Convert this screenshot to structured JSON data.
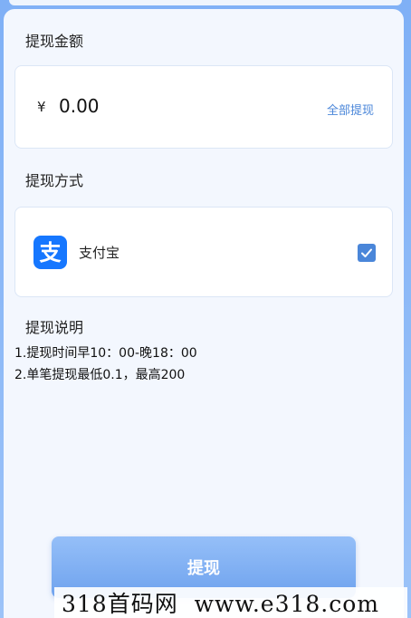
{
  "amount_section": {
    "title": "提现金额",
    "currency": "¥",
    "amount": "0.00",
    "withdraw_all_label": "全部提现"
  },
  "method_section": {
    "title": "提现方式",
    "method_icon_text": "支",
    "method_label": "支付宝",
    "selected": true,
    "accent_color": "#4a86d9",
    "icon_color": "#1677ff",
    "icon": "check-icon"
  },
  "notes_section": {
    "title": "提现说明",
    "lines": [
      "1.提现时间早10：00-晚18：00",
      "2.单笔提现最低0.1，最高200"
    ]
  },
  "submit_label": "提现",
  "watermark_text": "318首码网  www.e318.com"
}
